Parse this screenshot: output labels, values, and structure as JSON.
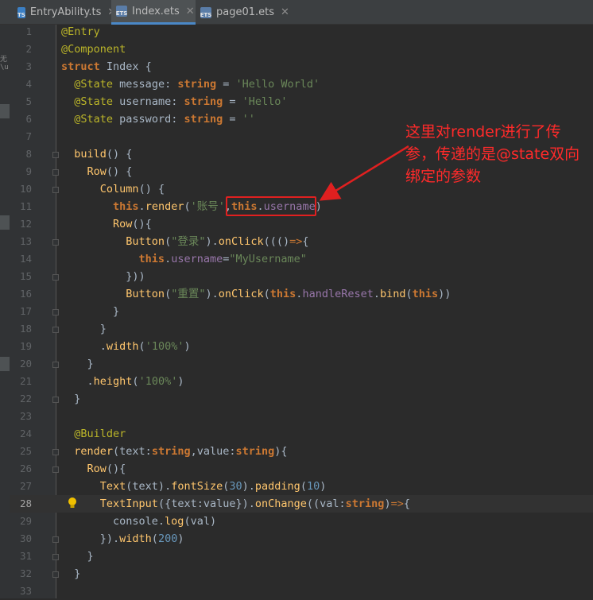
{
  "tabs": [
    {
      "icon": "TS",
      "label": "EntryAbility.ts",
      "active": false
    },
    {
      "icon": "ETS",
      "label": "Index.ets",
      "active": true
    },
    {
      "icon": "ETS",
      "label": "page01.ets",
      "active": false
    }
  ],
  "left_strip_text": "无\\u",
  "current_line": 28,
  "code_lines": [
    {
      "n": 1,
      "text": "@Entry"
    },
    {
      "n": 2,
      "text": "@Component"
    },
    {
      "n": 3,
      "text": "struct Index {"
    },
    {
      "n": 4,
      "text": "  @State message: string = 'Hello World'"
    },
    {
      "n": 5,
      "text": "  @State username: string = 'Hello'"
    },
    {
      "n": 6,
      "text": "  @State password: string = ''"
    },
    {
      "n": 7,
      "text": ""
    },
    {
      "n": 8,
      "text": "  build() {"
    },
    {
      "n": 9,
      "text": "    Row() {"
    },
    {
      "n": 10,
      "text": "      Column() {"
    },
    {
      "n": 11,
      "text": "        this.render('账号',this.username)"
    },
    {
      "n": 12,
      "text": "        Row(){"
    },
    {
      "n": 13,
      "text": "          Button(\"登录\").onClick((()=>{"
    },
    {
      "n": 14,
      "text": "            this.username=\"MyUsername\""
    },
    {
      "n": 15,
      "text": "          }))"
    },
    {
      "n": 16,
      "text": "          Button(\"重置\").onClick(this.handleReset.bind(this))"
    },
    {
      "n": 17,
      "text": "        }"
    },
    {
      "n": 18,
      "text": "      }"
    },
    {
      "n": 19,
      "text": "      .width('100%')"
    },
    {
      "n": 20,
      "text": "    }"
    },
    {
      "n": 21,
      "text": "    .height('100%')"
    },
    {
      "n": 22,
      "text": "  }"
    },
    {
      "n": 23,
      "text": ""
    },
    {
      "n": 24,
      "text": "  @Builder"
    },
    {
      "n": 25,
      "text": "  render(text:string,value:string){"
    },
    {
      "n": 26,
      "text": "    Row(){"
    },
    {
      "n": 27,
      "text": "      Text(text).fontSize(30).padding(10)"
    },
    {
      "n": 28,
      "text": "      TextInput({text:value}).onChange((val:string)=>{"
    },
    {
      "n": 29,
      "text": "        console.log(val)"
    },
    {
      "n": 30,
      "text": "      }).width(200)"
    },
    {
      "n": 31,
      "text": "    }"
    },
    {
      "n": 32,
      "text": "  }"
    },
    {
      "n": 33,
      "text": ""
    }
  ],
  "annotation": "这里对render进行了传参，传递的是@state双向绑定的参数",
  "colors": {
    "background": "#2b2b2b",
    "keyword": "#cc7832",
    "annotation": "#bbb529",
    "string": "#6a8759",
    "function": "#ffc66d",
    "property": "#9876aa",
    "number": "#6897bb",
    "highlight_box": "#e02020",
    "note_text": "#ff2a2a"
  }
}
